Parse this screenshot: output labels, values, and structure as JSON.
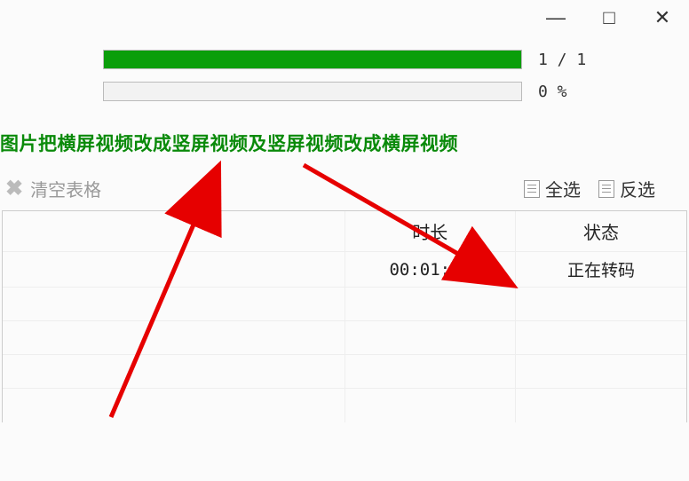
{
  "titlebar": {
    "minimize": "—",
    "maximize": "□",
    "close": "✕"
  },
  "progress": {
    "bar1_percent": 100,
    "bar1_label": "1 / 1",
    "bar2_percent": 0,
    "bar2_label": "0 %"
  },
  "description": "图片把横屏视频改成竖屏视频及竖屏视频改成横屏视频",
  "toolbar": {
    "clear_label": "清空表格",
    "select_all": "全选",
    "invert": "反选"
  },
  "table": {
    "headers": {
      "duration": "时长",
      "status": "状态"
    },
    "rows": [
      {
        "duration": "00:01:35",
        "status": "正在转码"
      },
      {
        "duration": "",
        "status": ""
      },
      {
        "duration": "",
        "status": ""
      },
      {
        "duration": "",
        "status": ""
      },
      {
        "duration": "",
        "status": ""
      }
    ]
  }
}
